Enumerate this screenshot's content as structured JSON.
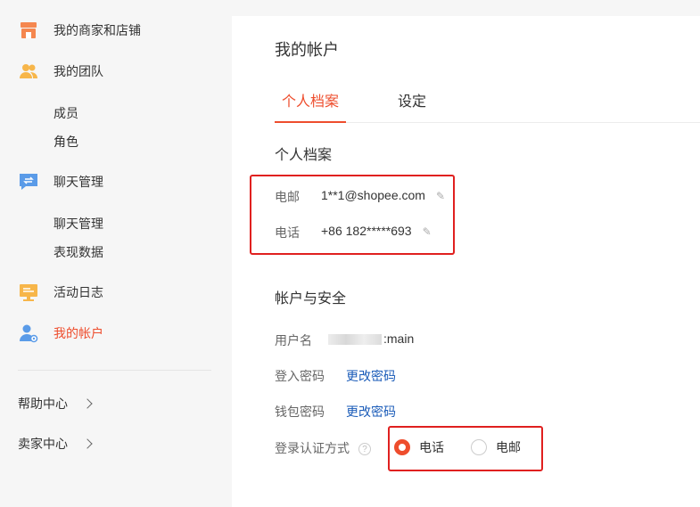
{
  "sidebar": {
    "items": [
      {
        "label": "我的商家和店铺",
        "icon": "shop-icon"
      },
      {
        "label": "我的团队",
        "icon": "team-icon",
        "sub": [
          "成员",
          "角色"
        ]
      },
      {
        "label": "聊天管理",
        "icon": "chat-icon",
        "sub": [
          "聊天管理",
          "表现数据"
        ]
      },
      {
        "label": "活动日志",
        "icon": "activity-log-icon"
      },
      {
        "label": "我的帐户",
        "icon": "account-icon",
        "active": true
      }
    ],
    "footer": [
      "帮助中心",
      "卖家中心"
    ]
  },
  "main": {
    "title": "我的帐户",
    "tabs": [
      "个人档案",
      "设定"
    ],
    "profile": {
      "title": "个人档案",
      "email_label": "电邮",
      "email_value": "1**1@shopee.com",
      "phone_label": "电话",
      "phone_value": "+86 182*****693"
    },
    "security": {
      "title": "帐户与安全",
      "username_label": "用户名",
      "username_suffix": ":main",
      "password_label": "登入密码",
      "password_link": "更改密码",
      "wallet_label": "钱包密码",
      "wallet_link": "更改密码",
      "auth_label": "登录认证方式",
      "auth_options": [
        "电话",
        "电邮"
      ],
      "auth_selected": "电话"
    }
  },
  "colors": {
    "accent": "#ee4d2d",
    "link": "#1a5bb8",
    "highlight_box": "#e0201f"
  }
}
